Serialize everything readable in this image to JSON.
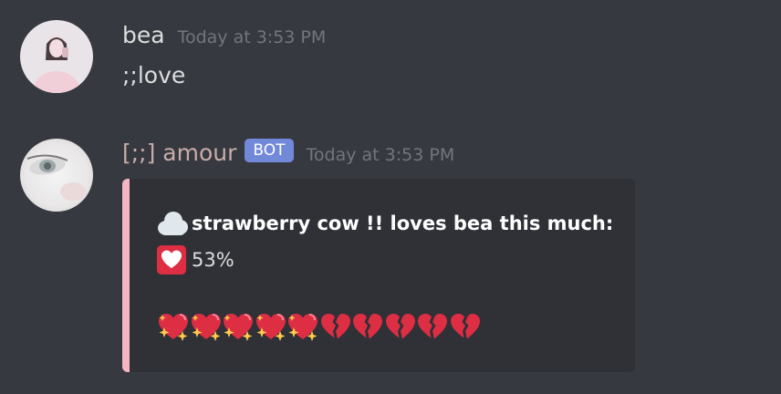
{
  "messages": [
    {
      "username": "bea",
      "username_color": "#dcddde",
      "timestamp": "Today at 3:53 PM",
      "content": ";;love"
    },
    {
      "username": "[;;] amour",
      "username_color": "#c9aca9",
      "bot_tag": "BOT",
      "timestamp": "Today at 3:53 PM",
      "embed": {
        "accent_color": "#f5b5c1",
        "line1_name": "strawberry cow !!",
        "line1_verb": " loves ",
        "line1_target": "bea",
        "line1_rest": " this much:",
        "percent_text": "53%",
        "love_percent": 53,
        "bar": {
          "filled_icon": "sparkling-heart-icon",
          "empty_icon": "broken-heart-icon",
          "filled_count": 5,
          "empty_count": 5
        },
        "icons": {
          "title": "cloud-icon",
          "percent": "white-heart-box-icon"
        }
      }
    }
  ]
}
